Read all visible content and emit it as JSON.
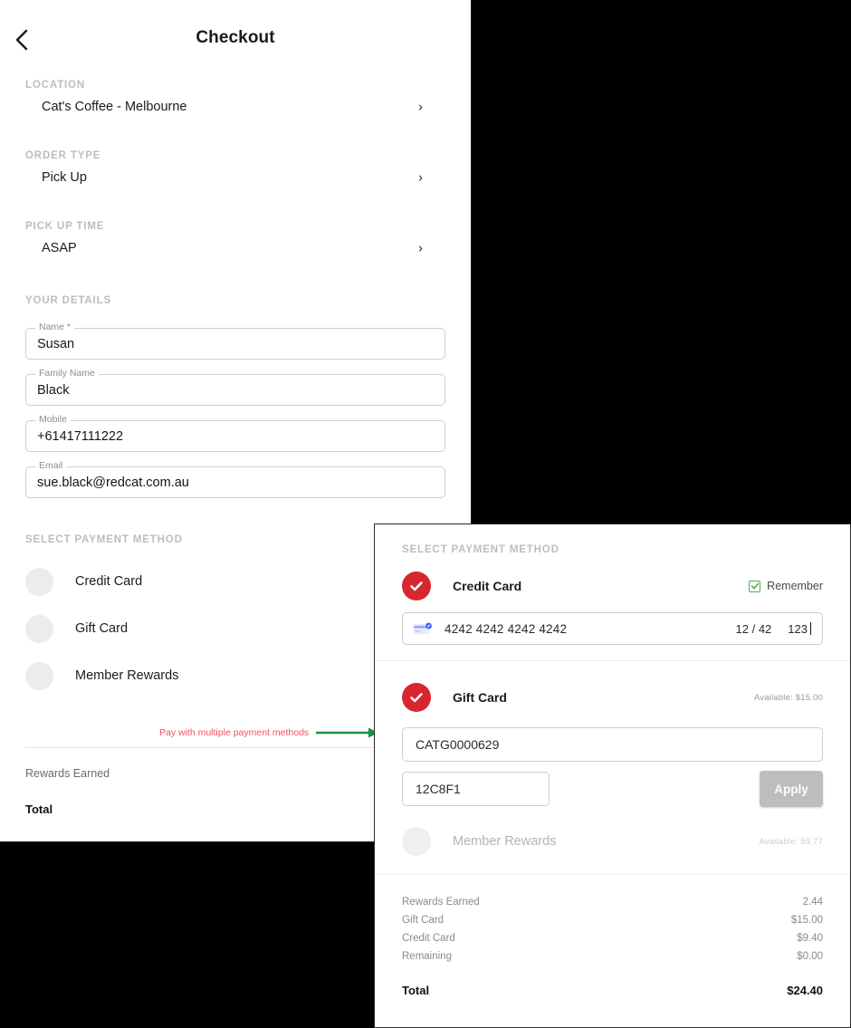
{
  "colors": {
    "accent_red": "#d8262f",
    "annotation_red": "#f4515b",
    "annotation_green": "#1e8f3c",
    "checkbox_green": "#4caf50",
    "apply_gray": "#bdbdbd",
    "muted_gray": "#bdbdbd"
  },
  "base_screen": {
    "title": "Checkout",
    "back_icon": "chevron-left-icon",
    "sections": [
      {
        "label": "LOCATION",
        "value": "Cat's Coffee - Melbourne",
        "chevron": "chevron-right-icon"
      },
      {
        "label": "ORDER TYPE",
        "value": "Pick Up",
        "chevron": "chevron-right-icon"
      },
      {
        "label": "PICK UP TIME",
        "value": "ASAP",
        "chevron": "chevron-right-icon"
      }
    ],
    "details_label": "YOUR DETAILS",
    "fields": [
      {
        "legend": "Name *",
        "value": "Susan"
      },
      {
        "legend": "Family Name",
        "value": "Black"
      },
      {
        "legend": "Mobile",
        "value": "+61417111222"
      },
      {
        "legend": "Email",
        "value": "sue.black@redcat.com.au"
      }
    ],
    "payment_label": "SELECT PAYMENT METHOD",
    "payment_methods": [
      {
        "label": "Credit Card",
        "selected": false
      },
      {
        "label": "Gift Card",
        "selected": false
      },
      {
        "label": "Member Rewards",
        "selected": false
      }
    ],
    "summary": [
      {
        "label": "Rewards Earned",
        "value": ""
      }
    ],
    "total_label": "Total",
    "total_value": ""
  },
  "annotation": {
    "text": "Pay with multiple payment methods",
    "arrow_icon": "arrow-right-icon"
  },
  "overlay": {
    "payment_label": "SELECT PAYMENT METHOD",
    "credit_card": {
      "label": "Credit Card",
      "selected": true,
      "check_icon": "check-circle-icon",
      "remember_label": "Remember",
      "remember_checked": true,
      "card_brand_icon": "visa-card-icon",
      "card_number": "4242 4242 4242 4242",
      "card_expiry": "12 / 42",
      "card_cvc": "123"
    },
    "gift_card": {
      "label": "Gift Card",
      "selected": true,
      "check_icon": "check-circle-icon",
      "available": "Available: $15.00",
      "number": "CATG0000629",
      "pin": "12C8F1",
      "apply_label": "Apply"
    },
    "member_rewards": {
      "label": "Member Rewards",
      "selected": false,
      "available": "Available: 59.77"
    },
    "summary": [
      {
        "label": "Rewards Earned",
        "value": "2.44"
      },
      {
        "label": "Gift Card",
        "value": "$15.00"
      },
      {
        "label": "Credit Card",
        "value": "$9.40"
      },
      {
        "label": "Remaining",
        "value": "$0.00"
      }
    ],
    "total_label": "Total",
    "total_value": "$24.40"
  }
}
